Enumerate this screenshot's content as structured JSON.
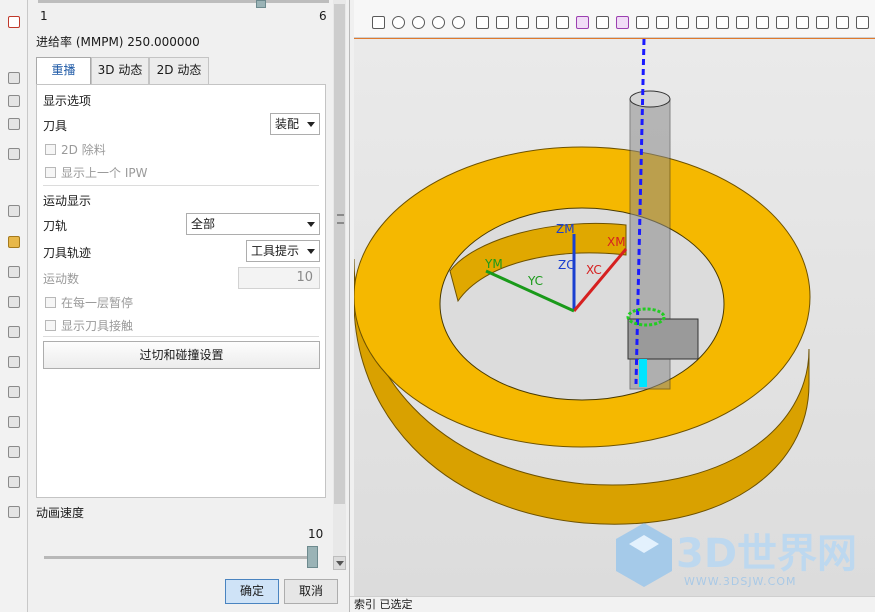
{
  "dialog": {
    "range_min": "1",
    "range_max": "6",
    "feed_rate": "进给率 (MMPM) 250.000000",
    "tabs": [
      {
        "label": "重播",
        "active": true
      },
      {
        "label": "3D 动态",
        "active": false
      },
      {
        "label": "2D 动态",
        "active": false
      }
    ],
    "display_options": {
      "heading": "显示选项",
      "tool_label": "刀具",
      "tool_value": "装配",
      "remove_2d": "2D 除料",
      "show_prev_ipw": "显示上一个 IPW"
    },
    "motion_display": {
      "heading": "运动显示",
      "toolpath_label": "刀轨",
      "toolpath_value": "全部",
      "tool_trace_label": "刀具轨迹",
      "tool_trace_value": "工具提示",
      "motion_count_label": "运动数",
      "motion_count_value": "10",
      "pause_each_layer": "在每一层暂停",
      "show_tool_contact": "显示刀具接触"
    },
    "gouge_button": "过切和碰撞设置",
    "animation_speed_label": "动画速度",
    "animation_speed_value": "10",
    "animation_speed_level": 10,
    "ok_button": "确定",
    "cancel_button": "取消"
  },
  "viewport": {
    "axis_labels": {
      "zm": "ZM",
      "zc": "ZC",
      "xm": "XM",
      "xc": "XC",
      "ym": "YM",
      "yc": "YC"
    },
    "watermark_text": "3D世界网",
    "watermark_url": "WWW.3DSJW.COM",
    "part_color": "#f5b800",
    "part_edge_color": "#6e5200"
  },
  "status_bar": {
    "text": "索引 已选定"
  },
  "colors": {
    "accent_tab": "#1f5aa6",
    "ok_button_bg": "#cfe3f7",
    "toolpath_blue": "#1a1aff",
    "tool_contact_green": "#22cc22",
    "toolbar_border_orange": "#e07a2e"
  }
}
